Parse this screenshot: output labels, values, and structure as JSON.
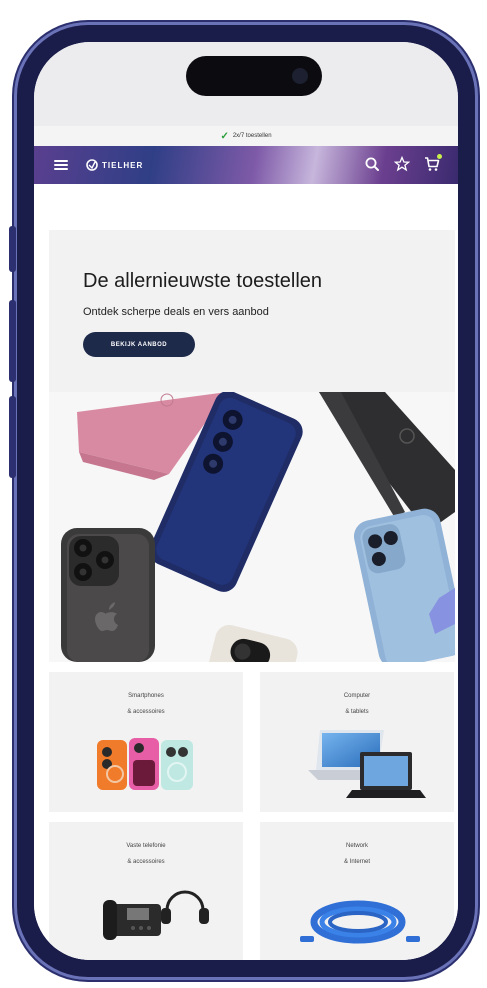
{
  "notice": {
    "text": "2x/7 toestellen"
  },
  "header": {
    "logo": "TIELHER"
  },
  "hero": {
    "title": "De allernieuwste toestellen",
    "subtitle": "Ontdek scherpe deals en vers aanbod",
    "button": "BEKIJK AANBOD"
  },
  "categories": [
    {
      "line1": "Smartphones",
      "line2": "& accessoires"
    },
    {
      "line1": "Computer",
      "line2": "& tablets"
    },
    {
      "line1": "Vaste telefonie",
      "line2": "& accessoires"
    },
    {
      "line1": "Network",
      "line2": "& Internet"
    }
  ],
  "colors": {
    "accent": "#1e2a4a",
    "check": "#2a9d3a",
    "frame": "#1a1c4a"
  }
}
